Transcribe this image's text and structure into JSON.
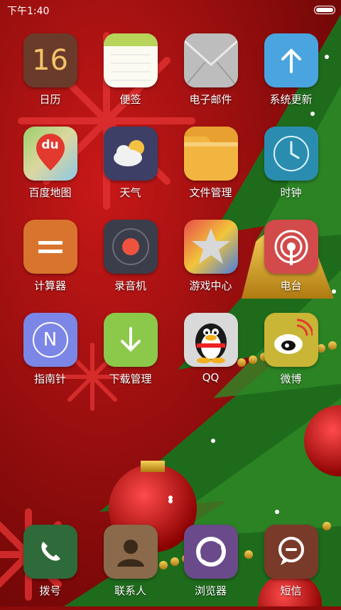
{
  "status_bar": {
    "time": "下午1:40"
  },
  "apps": [
    {
      "label": "日历",
      "icon": "calendar-icon",
      "day": "16"
    },
    {
      "label": "便签",
      "icon": "notes-icon"
    },
    {
      "label": "电子邮件",
      "icon": "email-icon"
    },
    {
      "label": "系统更新",
      "icon": "system-update-icon"
    },
    {
      "label": "百度地图",
      "icon": "baidu-map-icon",
      "logo_text": "du"
    },
    {
      "label": "天气",
      "icon": "weather-icon"
    },
    {
      "label": "文件管理",
      "icon": "folder-icon"
    },
    {
      "label": "时钟",
      "icon": "clock-icon"
    },
    {
      "label": "计算器",
      "icon": "calculator-icon"
    },
    {
      "label": "录音机",
      "icon": "recorder-icon"
    },
    {
      "label": "游戏中心",
      "icon": "game-center-icon"
    },
    {
      "label": "电台",
      "icon": "radio-icon"
    },
    {
      "label": "指南针",
      "icon": "compass-icon",
      "logo_text": "N"
    },
    {
      "label": "下载管理",
      "icon": "download-icon"
    },
    {
      "label": "QQ",
      "icon": "qq-penguin-icon"
    },
    {
      "label": "微博",
      "icon": "weibo-icon"
    }
  ],
  "dock": [
    {
      "label": "拨号",
      "icon": "phone-icon"
    },
    {
      "label": "联系人",
      "icon": "contacts-icon"
    },
    {
      "label": "浏览器",
      "icon": "browser-icon"
    },
    {
      "label": "短信",
      "icon": "messages-icon"
    }
  ]
}
